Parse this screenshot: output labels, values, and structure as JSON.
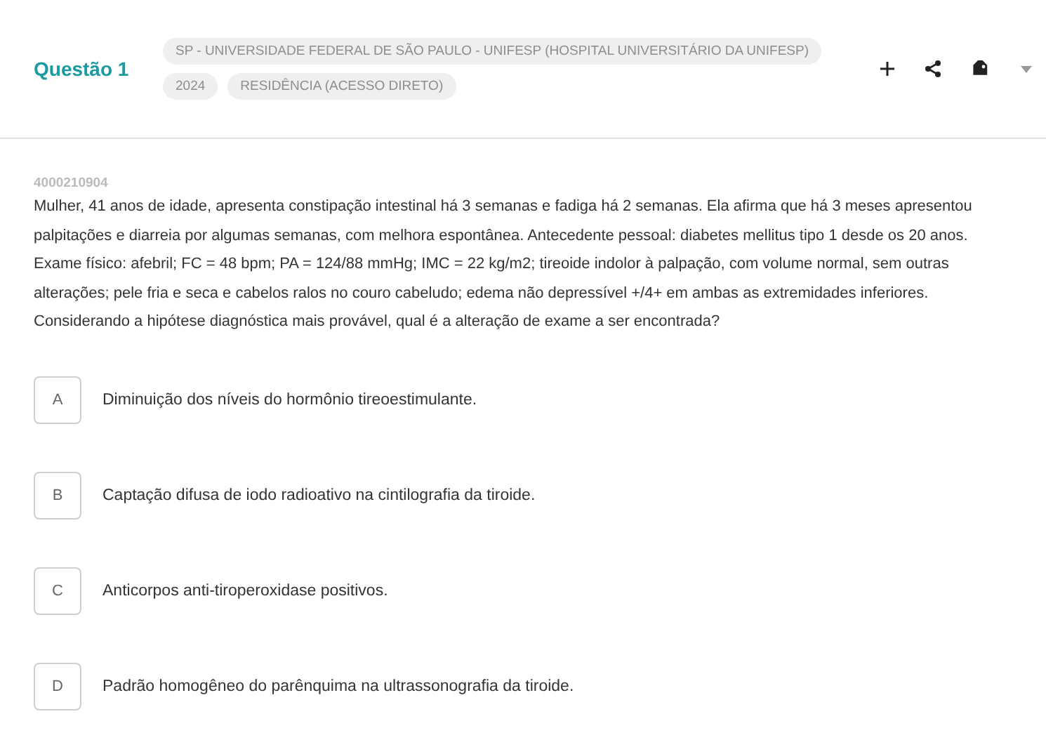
{
  "header": {
    "title": "Questão 1",
    "tags": [
      [
        "SP - UNIVERSIDADE FEDERAL DE SÃO PAULO - UNIFESP (HOSPITAL UNIVERSITÁRIO DA UNIFESP)"
      ],
      [
        "2024",
        "RESIDÊNCIA (ACESSO DIRETO)"
      ]
    ]
  },
  "question": {
    "id": "4000210904",
    "text": "Mulher, 41 anos de idade, apresenta constipação intestinal há 3 semanas e fadiga há 2 semanas. Ela afirma que há 3 meses apresentou palpitações e diarreia por algumas semanas, com melhora espontânea. Antecedente pessoal: diabetes mellitus tipo 1 desde os 20 anos. Exame físico: afebril; FC = 48 bpm; PA = 124/88 mmHg; IMC = 22 kg/m2; tireoide indolor à palpação, com volume normal, sem outras alterações; pele fria e seca e cabelos ralos no couro cabeludo; edema não depressível +/4+ em ambas as extremidades inferiores. Considerando a hipótese diagnóstica mais provável, qual é a alteração de exame a ser encontrada?"
  },
  "options": [
    {
      "letter": "A",
      "text": "Diminuição dos níveis do hormônio tireoestimulante.",
      "selected": false
    },
    {
      "letter": "B",
      "text": "Captação difusa de iodo radioativo na cintilografia da tiroide.",
      "selected": false
    },
    {
      "letter": "C",
      "text": "Anticorpos anti-tiroperoxidase positivos.",
      "selected": false
    },
    {
      "letter": "D",
      "text": "Padrão homogêneo do parênquima na ultrassonografia da tiroide.",
      "selected": false
    }
  ]
}
